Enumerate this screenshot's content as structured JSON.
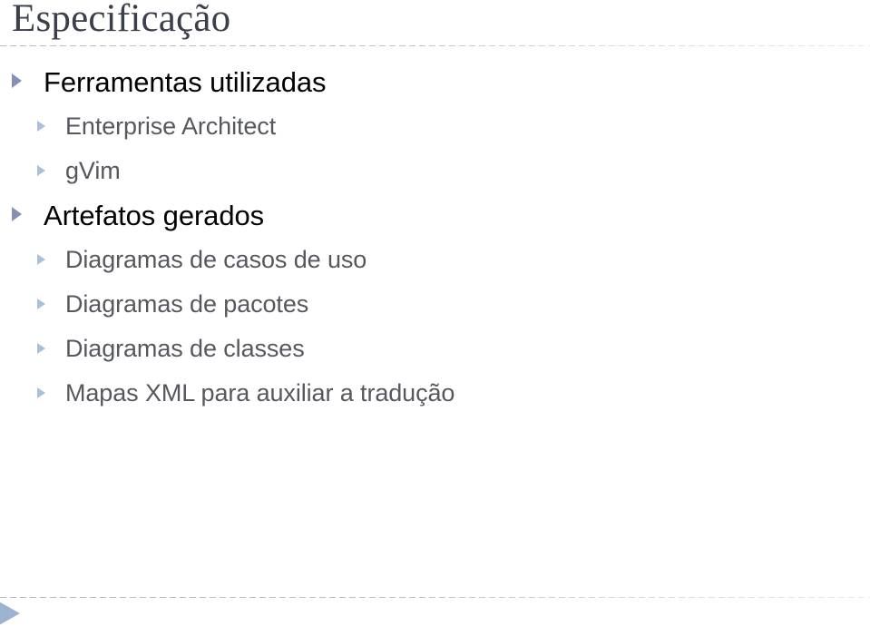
{
  "slide": {
    "title": "Especificação",
    "background_color": "#ffffff",
    "title_color": "#3b3f4b",
    "rule_color": "#bfc2c9",
    "level1_text_color": "#000000",
    "level1_marker_color": "#8690b5",
    "level2_text_color": "#55585e",
    "level2_marker_color": "#a8c0d8",
    "footer_arrow_color": "#9cb4cf"
  },
  "bullets": [
    {
      "level": 1,
      "text": "Ferramentas utilizadas"
    },
    {
      "level": 2,
      "text": "Enterprise Architect"
    },
    {
      "level": 2,
      "text": "gVim"
    },
    {
      "level": 1,
      "text": "Artefatos gerados"
    },
    {
      "level": 2,
      "text": "Diagramas de casos de uso"
    },
    {
      "level": 2,
      "text": "Diagramas de pacotes"
    },
    {
      "level": 2,
      "text": "Diagramas de classes"
    },
    {
      "level": 2,
      "text": "Mapas XML para auxiliar a tradução"
    }
  ],
  "footer": {
    "nav_icon": "triangle-right-icon"
  }
}
